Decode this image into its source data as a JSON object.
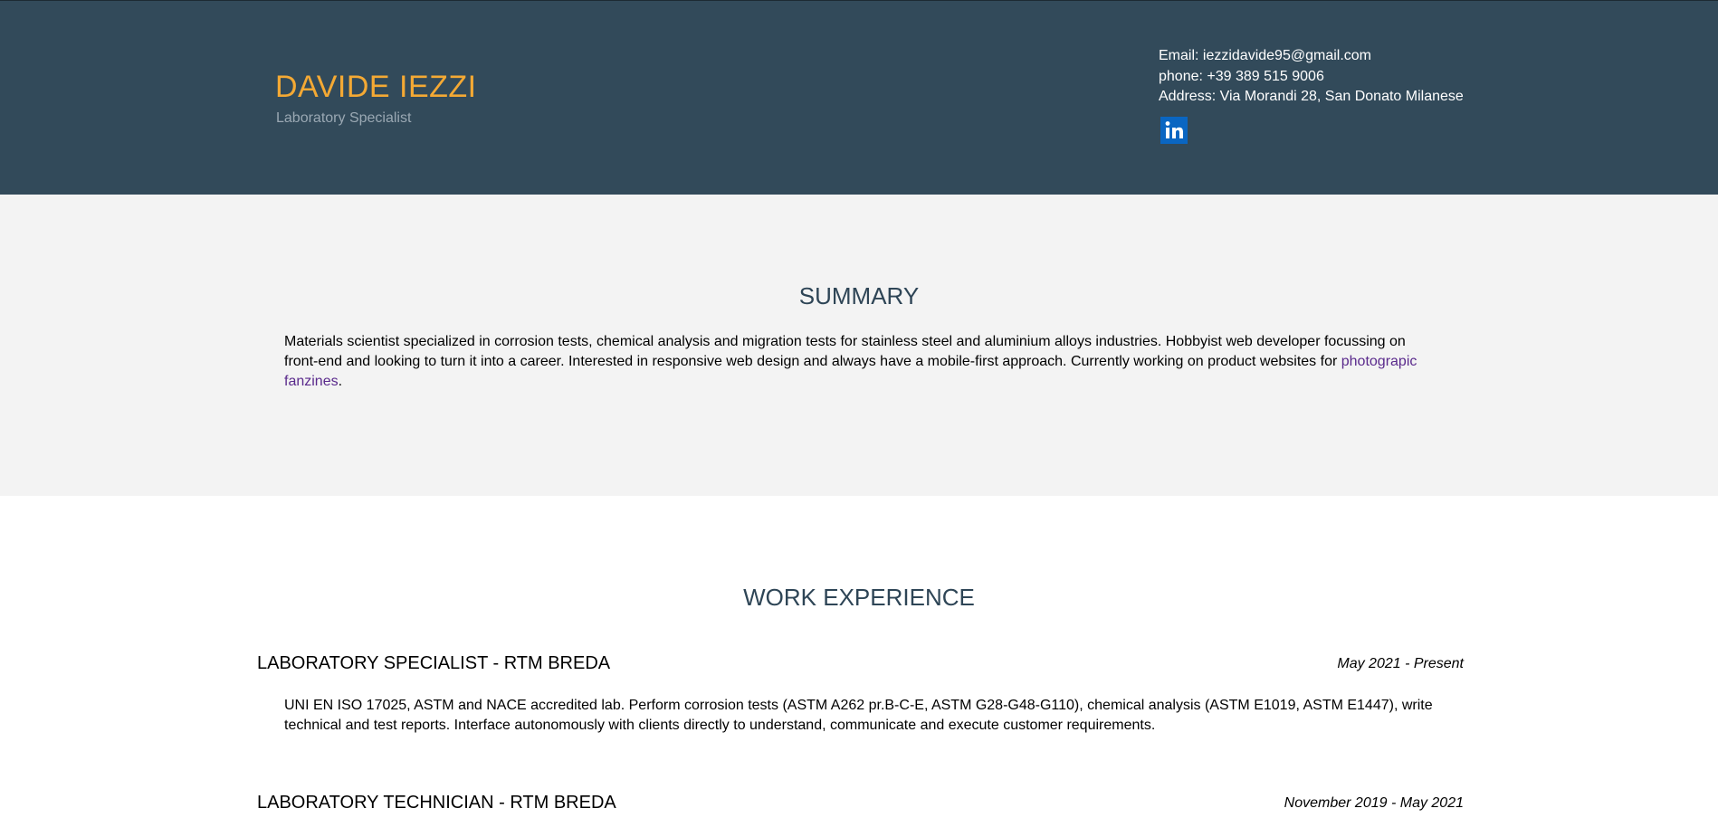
{
  "header": {
    "name": "DAVIDE IEZZI",
    "role": "Laboratory Specialist",
    "contact": {
      "email": "Email: iezzidavide95@gmail.com",
      "phone": "phone: +39 389 515 9006",
      "address": "Address: Via Morandi 28, San Donato Milanese"
    },
    "social_icon": "linkedin-icon"
  },
  "summary": {
    "title": "SUMMARY",
    "text": "Materials scientist specialized in corrosion tests, chemical analysis and migration tests for stainless steel and aluminium alloys industries. Hobbyist web developer focussing on front-end and looking to turn it into a career. Interested in responsive web design and always have a mobile-first approach. Currently working on product websites for ",
    "link_text": "photograpic fanzines",
    "after_link": "."
  },
  "work": {
    "title": "WORK EXPERIENCE",
    "jobs": [
      {
        "title": "LABORATORY SPECIALIST - RTM BREDA",
        "date": "May 2021 - Present",
        "description": "UNI EN ISO 17025, ASTM and NACE accredited lab. Perform corrosion tests (ASTM A262 pr.B-C-E, ASTM G28-G48-G110), chemical analysis (ASTM E1019, ASTM E1447), write technical and test reports. Interface autonomously with clients directly to understand, communicate and execute customer requirements."
      },
      {
        "title": "LABORATORY TECHNICIAN - RTM BREDA",
        "date": "November 2019 - May 2021"
      }
    ]
  },
  "colors": {
    "header_bg": "#324a5a",
    "name_accent": "#f4a934",
    "summary_bg": "#f3f3f3",
    "section_title": "#2e4556",
    "link": "#5a2a8c",
    "linkedin": "#0a66c2"
  }
}
